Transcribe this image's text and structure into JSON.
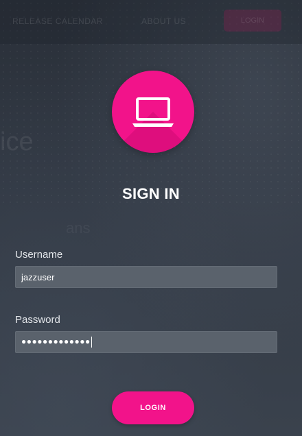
{
  "nav": {
    "release_calendar": "RELEASE CALENDAR",
    "about_us": "ABOUT US",
    "login": "LOGIN"
  },
  "background_text": {
    "large": "ice",
    "small": "ans"
  },
  "icons": {
    "avatar": "laptop-icon"
  },
  "colors": {
    "accent": "#f2138a",
    "background": "#2f3640",
    "input_bg": "#5a626c"
  },
  "form": {
    "title": "SIGN IN",
    "username_label": "Username",
    "username_value": "jazzuser",
    "password_label": "Password",
    "password_masked": "●●●●●●●●●●●●●",
    "submit_label": "LOGIN"
  }
}
